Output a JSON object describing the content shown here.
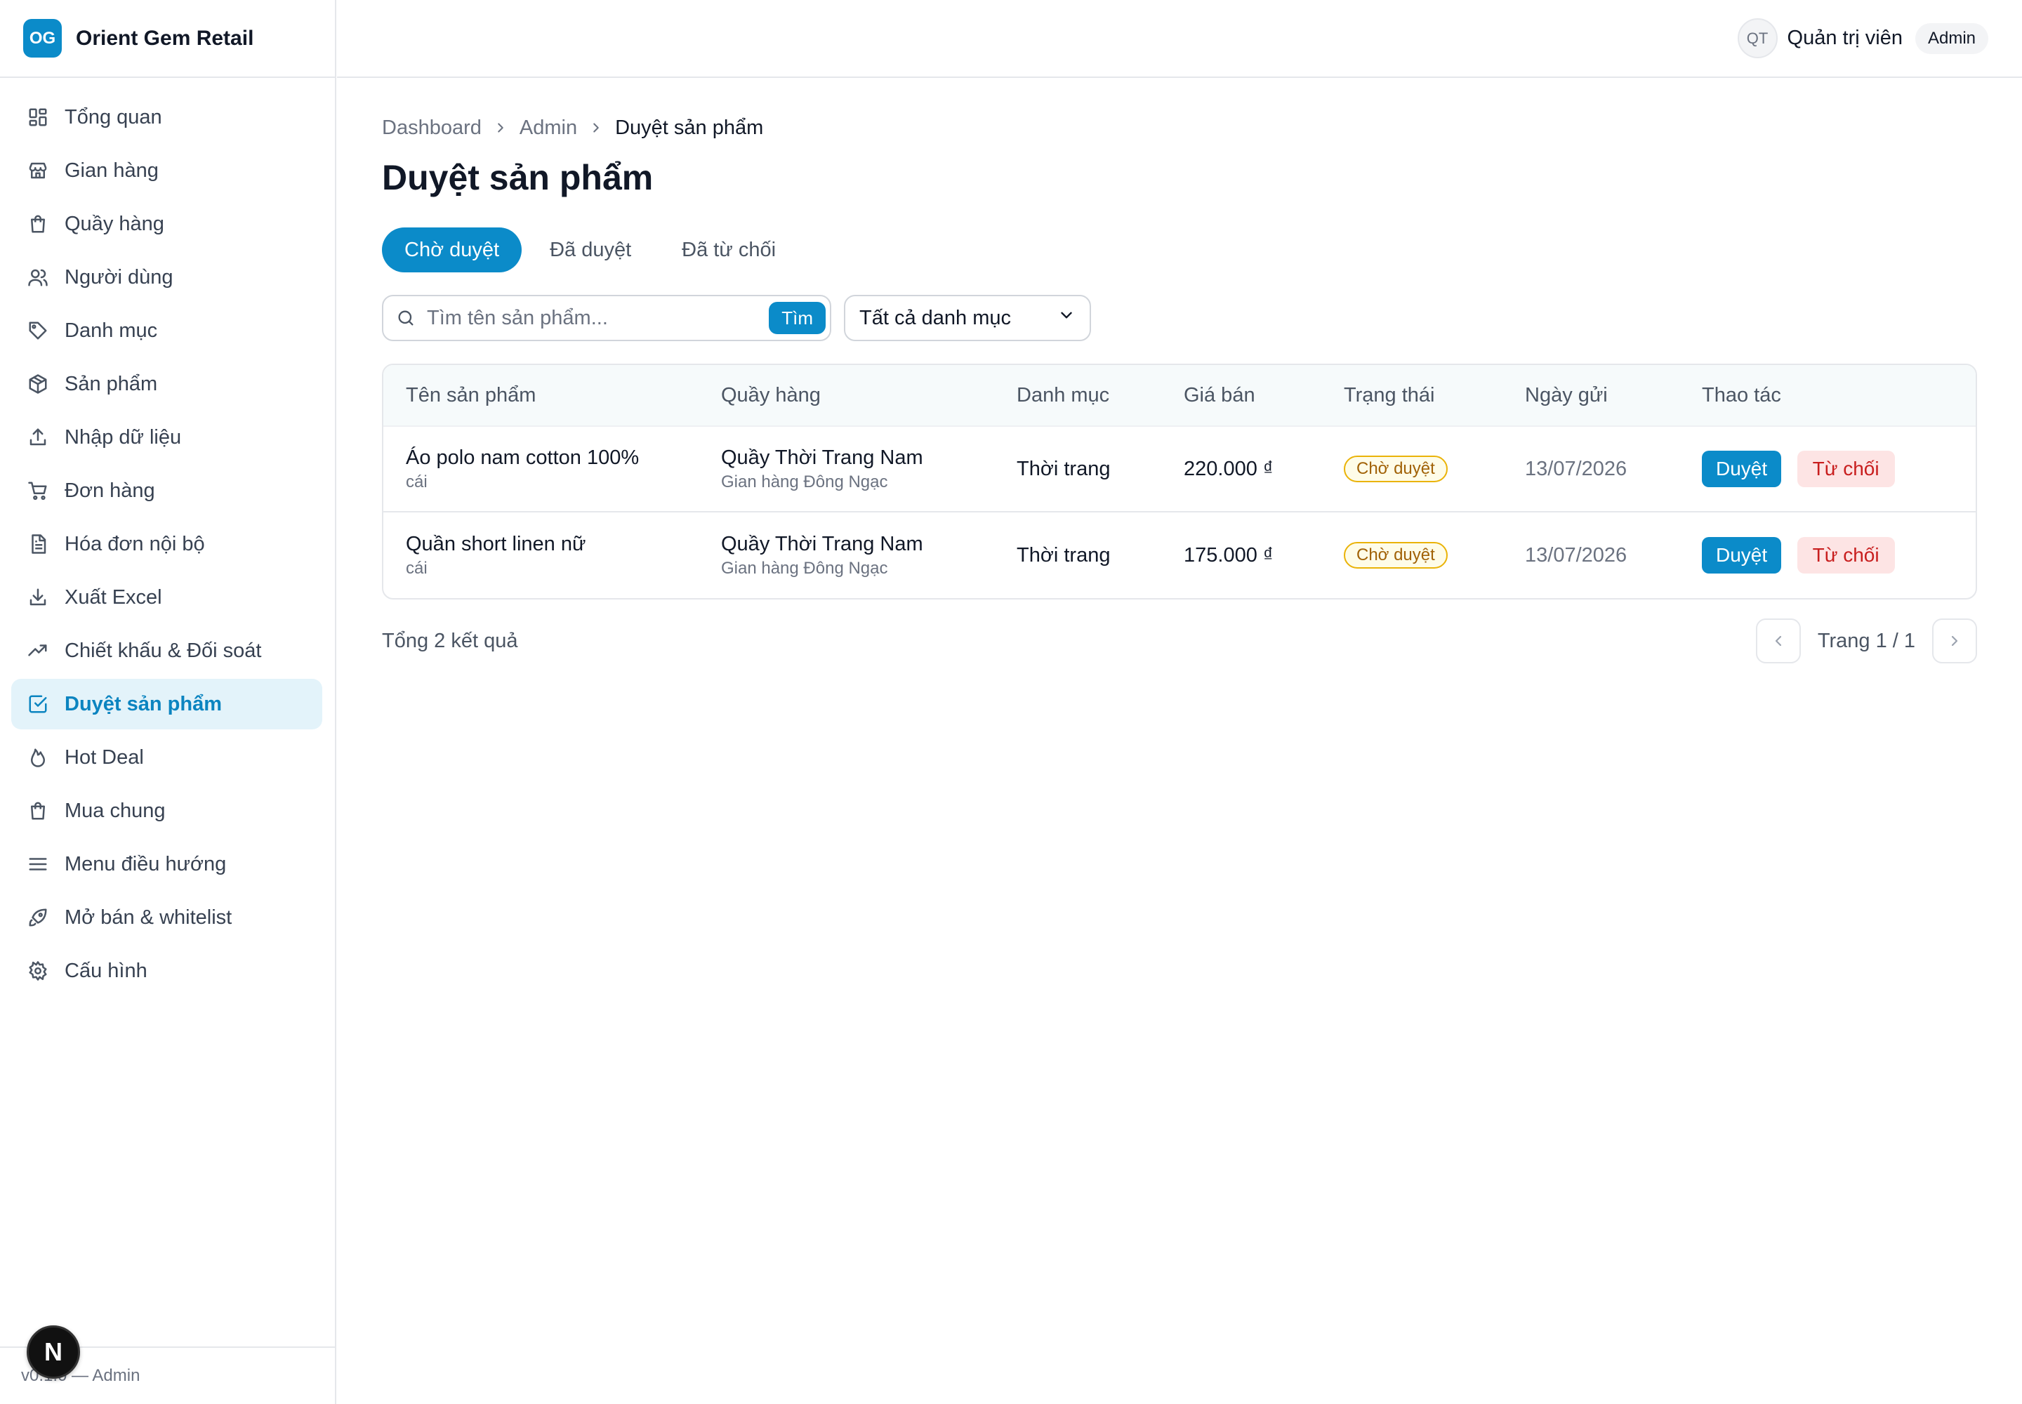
{
  "brand": {
    "logo": "OG",
    "name": "Orient Gem Retail"
  },
  "sidebar": {
    "items": [
      {
        "label": "Tổng quan",
        "icon": "dashboard-icon"
      },
      {
        "label": "Gian hàng",
        "icon": "store-icon"
      },
      {
        "label": "Quầy hàng",
        "icon": "shopping-bag-icon"
      },
      {
        "label": "Người dùng",
        "icon": "users-icon"
      },
      {
        "label": "Danh mục",
        "icon": "tag-icon"
      },
      {
        "label": "Sản phẩm",
        "icon": "package-icon"
      },
      {
        "label": "Nhập dữ liệu",
        "icon": "upload-icon"
      },
      {
        "label": "Đơn hàng",
        "icon": "cart-icon"
      },
      {
        "label": "Hóa đơn nội bộ",
        "icon": "file-text-icon"
      },
      {
        "label": "Xuất Excel",
        "icon": "download-icon"
      },
      {
        "label": "Chiết khấu & Đối soát",
        "icon": "trending-up-icon"
      },
      {
        "label": "Duyệt sản phẩm",
        "icon": "check-square-icon",
        "active": true
      },
      {
        "label": "Hot Deal",
        "icon": "flame-icon"
      },
      {
        "label": "Mua chung",
        "icon": "shopping-bag-icon"
      },
      {
        "label": "Menu điều hướng",
        "icon": "menu-icon"
      },
      {
        "label": "Mở bán & whitelist",
        "icon": "rocket-icon"
      },
      {
        "label": "Cấu hình",
        "icon": "settings-icon"
      }
    ],
    "footer": "v0.1.0 — Admin"
  },
  "next_badge": "N",
  "topbar": {
    "avatar": "QT",
    "user_name": "Quản trị viên",
    "role": "Admin"
  },
  "breadcrumb": [
    "Dashboard",
    "Admin",
    "Duyệt sản phẩm"
  ],
  "page_title": "Duyệt sản phẩm",
  "tabs": [
    {
      "label": "Chờ duyệt",
      "active": true
    },
    {
      "label": "Đã duyệt"
    },
    {
      "label": "Đã từ chối"
    }
  ],
  "search": {
    "placeholder": "Tìm tên sản phẩm...",
    "button": "Tìm"
  },
  "category_filter": {
    "selected": "Tất cả danh mục"
  },
  "table": {
    "headers": [
      "Tên sản phẩm",
      "Quầy hàng",
      "Danh mục",
      "Giá bán",
      "Trạng thái",
      "Ngày gửi",
      "Thao tác"
    ],
    "rows": [
      {
        "name": "Áo polo nam cotton 100%",
        "unit": "cái",
        "counter": "Quầy Thời Trang Nam",
        "store": "Gian hàng Đông Ngạc",
        "category": "Thời trang",
        "price": "220.000 ₫",
        "status": "Chờ duyệt",
        "date": "13/07/2026",
        "approve": "Duyệt",
        "reject": "Từ chối"
      },
      {
        "name": "Quần short linen nữ",
        "unit": "cái",
        "counter": "Quầy Thời Trang Nam",
        "store": "Gian hàng Đông Ngạc",
        "category": "Thời trang",
        "price": "175.000 ₫",
        "status": "Chờ duyệt",
        "date": "13/07/2026",
        "approve": "Duyệt",
        "reject": "Từ chối"
      }
    ]
  },
  "summary": {
    "total": "Tổng 2 kết quả",
    "page": "Trang 1 / 1"
  },
  "colors": {
    "primary": "#0b8bc9",
    "active_bg": "#e3f3fa",
    "reject_bg": "#fde4e4",
    "reject_text": "#c81e1e",
    "pending_border": "#eab308"
  }
}
